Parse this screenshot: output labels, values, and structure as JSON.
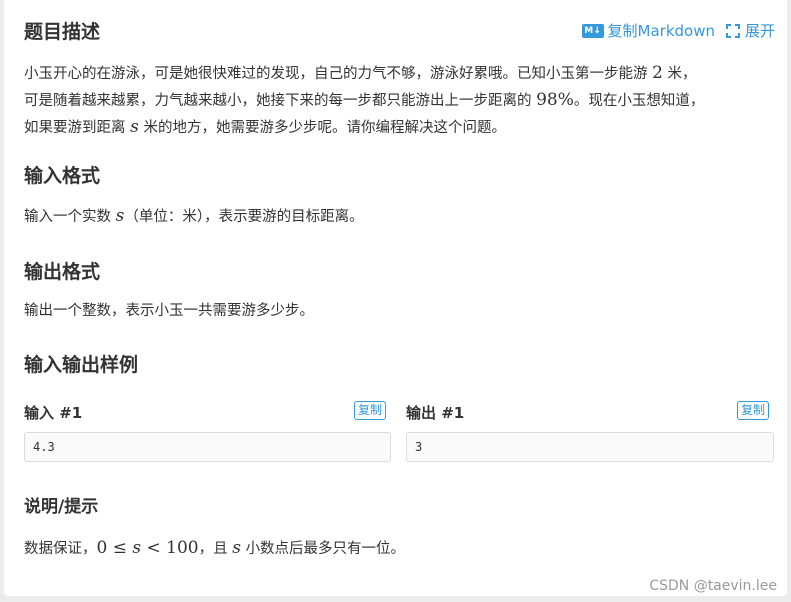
{
  "header": {
    "title": "题目描述",
    "copy_markdown": "复制Markdown",
    "md_badge": "M↓",
    "expand": "展开"
  },
  "description": {
    "p1": "小玉开心的在游泳，可是她很快难过的发现，自己的力气不够，游泳好累哦。已知小玉第一步能游",
    "v1": "2",
    "p2": "米，",
    "p3": "可是随着越来越累，力气越来越小，她接下来的每一步都只能游出上一步距离的",
    "v2": "98%",
    "p4": "。现在小玉想知道，",
    "p5": "如果要游到距离",
    "v3": "s",
    "p6": "米的地方，她需要游多少步呢。请你编程解决这个问题。"
  },
  "input_format": {
    "title": "输入格式",
    "p1": "输入一个实数",
    "v1": "s",
    "p2": "（单位：米），表示要游的目标距离。"
  },
  "output_format": {
    "title": "输出格式",
    "text": "输出一个整数，表示小玉一共需要游多少步。"
  },
  "samples": {
    "title": "输入输出样例",
    "input_label": "输入 #1",
    "output_label": "输出 #1",
    "copy_label": "复制",
    "input_value": "4.3",
    "output_value": "3"
  },
  "hint": {
    "title": "说明/提示",
    "p1": "数据保证，",
    "m1": "0 ≤ ",
    "m2": "s",
    "m3": " < 100",
    "p2": "，且",
    "v1": "s",
    "p3": "小数点后最多只有一位。"
  },
  "watermark": "CSDN @taevin.lee"
}
